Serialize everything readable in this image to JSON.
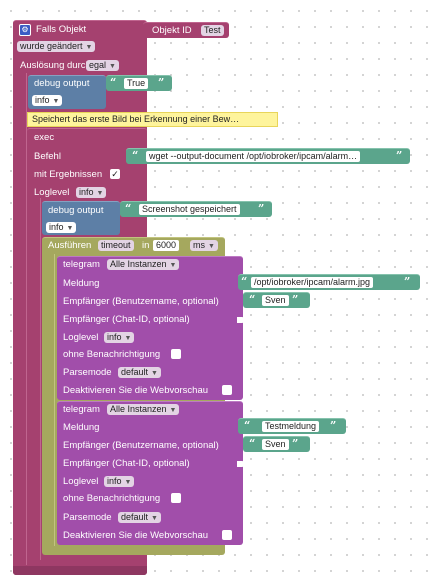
{
  "trigger": {
    "title": "Falls Objekt",
    "object_id_label": "Objekt ID",
    "object_id_value": "Test",
    "condition": "wurde geändert",
    "ack_label": "Auslösung durch",
    "ack_value": "egal"
  },
  "debug1": {
    "label": "debug output",
    "text": "True",
    "level": "info"
  },
  "comment": "Speichert das erste Bild bei Erkennung einer Bew…",
  "exec": {
    "label": "exec",
    "command_label": "Befehl",
    "command_value": "wget --output-document /opt/iobroker/ipcam/alarm…",
    "results_label": "mit Ergebnissen",
    "results_checked": "✓",
    "loglevel_label": "Loglevel",
    "loglevel_value": "info"
  },
  "debug2": {
    "label": "debug output",
    "text": "Screenshot gespeichert",
    "level": "info"
  },
  "timeout": {
    "label": "Ausführen",
    "mode": "timeout",
    "in_label": "in",
    "value": "6000",
    "unit": "ms"
  },
  "telegram1": {
    "label": "telegram",
    "instance": "Alle Instanzen",
    "message_label": "Meldung",
    "message_value": "/opt/iobroker/ipcam/alarm.jpg",
    "user_label": "Empfänger (Benutzername, optional)",
    "user_value": "Sven",
    "chat_label": "Empfänger (Chat-ID, optional)",
    "loglevel_label": "Loglevel",
    "loglevel_value": "info",
    "silent_label": "ohne Benachrichtigung",
    "parse_label": "Parsemode",
    "parse_value": "default",
    "preview_label": "Deaktivieren Sie die Webvorschau"
  },
  "telegram2": {
    "label": "telegram",
    "instance": "Alle Instanzen",
    "message_label": "Meldung",
    "message_value": "Testmeldung",
    "user_label": "Empfänger (Benutzername, optional)",
    "user_value": "Sven",
    "chat_label": "Empfänger (Chat-ID, optional)",
    "loglevel_label": "Loglevel",
    "loglevel_value": "info",
    "silent_label": "ohne Benachrichtigung",
    "parse_label": "Parsemode",
    "parse_value": "default",
    "preview_label": "Deaktivieren Sie die Webvorschau"
  },
  "colors": {
    "trigger": "#a5416f",
    "debug": "#5d7fa6",
    "timeout": "#a5a85e",
    "telegram": "#a14eaa",
    "string": "#5ba58c",
    "comment": "#fef49c"
  }
}
